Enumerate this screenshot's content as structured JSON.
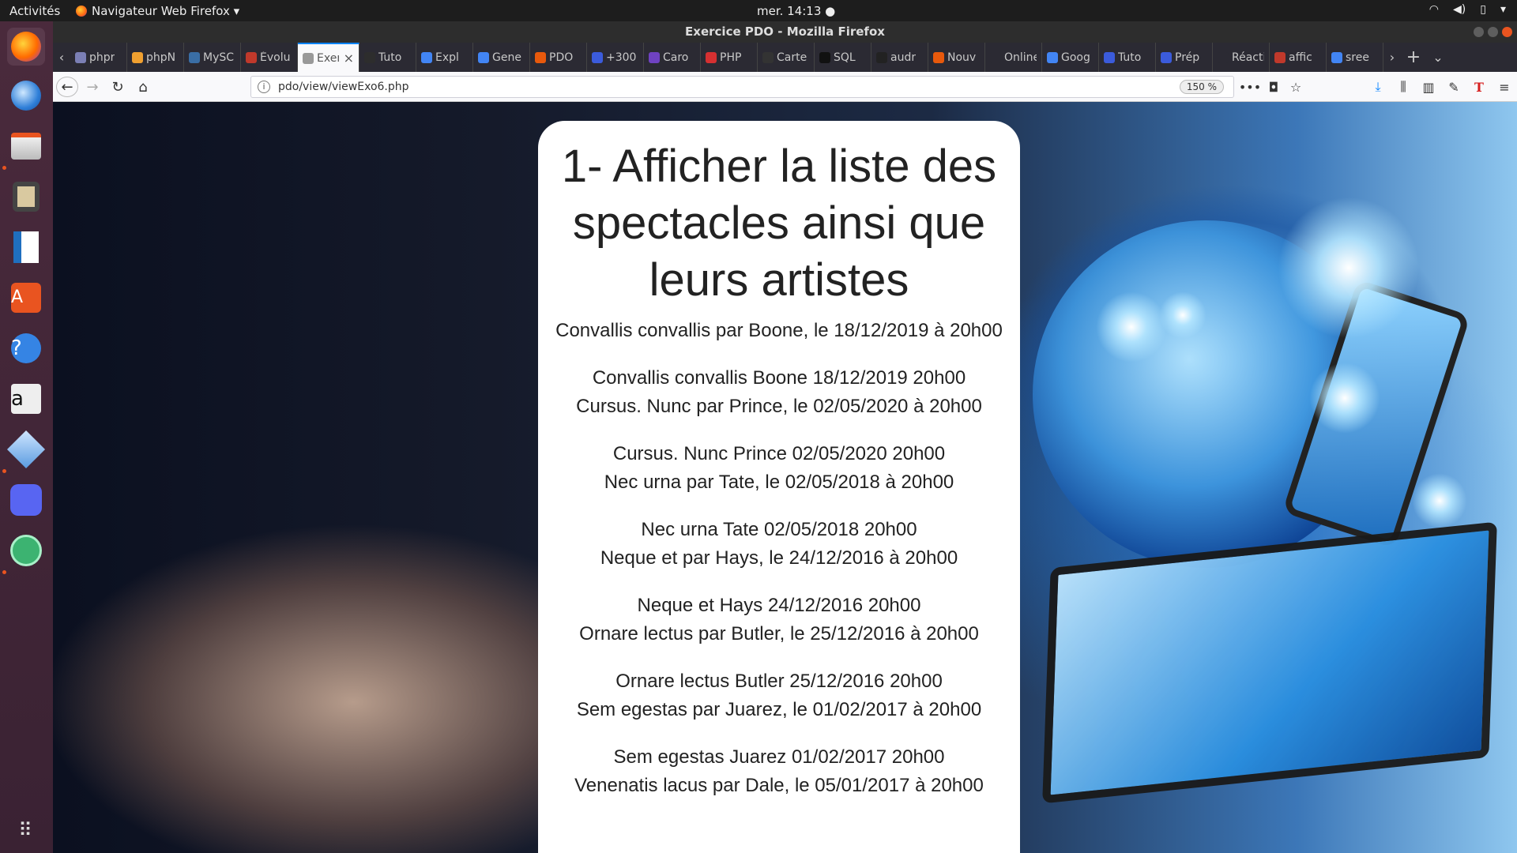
{
  "panel": {
    "activities": "Activités",
    "app_name": "Navigateur Web Firefox ▾",
    "clock": "mer. 14:13 ●"
  },
  "window": {
    "title": "Exercice PDO - Mozilla Firefox"
  },
  "dock": {
    "items": [
      "firefox-icon",
      "thunderbird-icon",
      "files-icon",
      "rhythmbox-icon",
      "writer-icon",
      "software-center-icon",
      "help-icon",
      "amazon-icon",
      "virtualbox-icon",
      "discord-icon",
      "atom-icon",
      "app-grid-icon"
    ]
  },
  "tabs": [
    {
      "label": "phpr",
      "color": "#7b7fb5"
    },
    {
      "label": "phpN",
      "color": "#f0a030"
    },
    {
      "label": "MySC",
      "color": "#3a6ea5"
    },
    {
      "label": "Évolu",
      "color": "#c0392b"
    },
    {
      "label": "Exerc",
      "color": "#999999",
      "active": true
    },
    {
      "label": "Tuto",
      "color": "#2d2d2d"
    },
    {
      "label": "Expl",
      "color": "#4285f4"
    },
    {
      "label": "Gene",
      "color": "#4285f4"
    },
    {
      "label": "PDO",
      "color": "#e8590c"
    },
    {
      "label": "+300",
      "color": "#3b5bdb"
    },
    {
      "label": "Caro",
      "color": "#6f42c1"
    },
    {
      "label": "PHP",
      "color": "#d63031"
    },
    {
      "label": "Carte",
      "color": "#333333"
    },
    {
      "label": "SQL",
      "color": "#111111"
    },
    {
      "label": "audr",
      "color": "#222222"
    },
    {
      "label": "Nouv",
      "color": "#e8590c"
    },
    {
      "label": "Online In",
      "color": "#2b2a33"
    },
    {
      "label": "Goog",
      "color": "#4285f4"
    },
    {
      "label": "Tuto",
      "color": "#3b5bdb"
    },
    {
      "label": "Prép",
      "color": "#3b5bdb"
    },
    {
      "label": "Réactio",
      "color": "#2b2a33"
    },
    {
      "label": "affic",
      "color": "#c0392b"
    },
    {
      "label": "sree",
      "color": "#4285f4"
    }
  ],
  "toolbar": {
    "url": "pdo/view/viewExo6.php",
    "zoom": "150 %"
  },
  "page": {
    "heading": "1- Afficher la liste des spectacles ainsi que leurs artistes",
    "entries": [
      [
        "Convallis convallis par Boone, le 18/12/2019 à 20h00"
      ],
      [
        "Convallis convallis Boone 18/12/2019 20h00",
        "Cursus. Nunc par Prince, le 02/05/2020 à 20h00"
      ],
      [
        "Cursus. Nunc Prince 02/05/2020 20h00",
        "Nec urna par Tate, le 02/05/2018 à 20h00"
      ],
      [
        "Nec urna Tate 02/05/2018 20h00",
        "Neque et par Hays, le 24/12/2016 à 20h00"
      ],
      [
        "Neque et Hays 24/12/2016 20h00",
        "Ornare lectus par Butler, le 25/12/2016 à 20h00"
      ],
      [
        "Ornare lectus Butler 25/12/2016 20h00",
        "Sem egestas par Juarez, le 01/02/2017 à 20h00"
      ],
      [
        "Sem egestas Juarez 01/02/2017 20h00",
        "Venenatis lacus par Dale, le 05/01/2017 à 20h00"
      ]
    ]
  },
  "colors": {
    "accent": "#0a84ff",
    "ubuntu_orange": "#e95420"
  }
}
